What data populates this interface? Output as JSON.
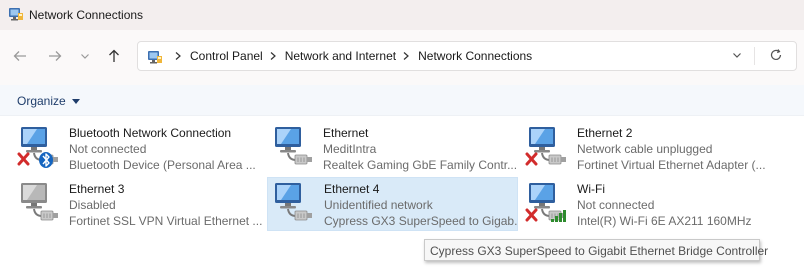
{
  "window": {
    "title": "Network Connections",
    "icon": "network-connections-icon"
  },
  "nav": {
    "back": "arrow-left-icon",
    "forward": "arrow-right-icon",
    "recent": "chevron-down-icon",
    "up": "arrow-up-icon"
  },
  "address": {
    "crumbs": [
      "Control Panel",
      "Network and Internet",
      "Network Connections"
    ],
    "dropdown": "chevron-down-icon",
    "refresh": "refresh-icon"
  },
  "commands": {
    "organize": "Organize"
  },
  "connections": [
    {
      "name": "Bluetooth Network Connection",
      "status": "Not connected",
      "device": "Bluetooth Device (Personal Area ...",
      "badge": "red-x-and-bluetooth",
      "enabled": true,
      "selected": false
    },
    {
      "name": "Ethernet",
      "status": "MeditIntra",
      "device": "Realtek Gaming GbE Family Contr...",
      "badge": "none",
      "enabled": true,
      "selected": false
    },
    {
      "name": "Ethernet 2",
      "status": "Network cable unplugged",
      "device": "Fortinet Virtual Ethernet Adapter (...",
      "badge": "red-x",
      "enabled": true,
      "selected": false
    },
    {
      "name": "Ethernet 3",
      "status": "Disabled",
      "device": "Fortinet SSL VPN Virtual Ethernet ...",
      "badge": "none",
      "enabled": false,
      "selected": false
    },
    {
      "name": "Ethernet 4",
      "status": "Unidentified network",
      "device": "Cypress GX3 SuperSpeed to Gigab...",
      "badge": "none",
      "enabled": true,
      "selected": true
    },
    {
      "name": "Wi-Fi",
      "status": "Not connected",
      "device": "Intel(R) Wi-Fi 6E AX211 160MHz",
      "badge": "red-x-and-signal",
      "enabled": true,
      "selected": false
    }
  ],
  "tooltip": {
    "text": "Cypress GX3 SuperSpeed to Gigabit Ethernet Bridge Controller"
  },
  "colors": {
    "accent": "#1f3d6b",
    "selection": "#d9eaf8",
    "error": "#d22c2c",
    "bluetooth": "#1565c0",
    "signal": "#2e8b2e"
  }
}
